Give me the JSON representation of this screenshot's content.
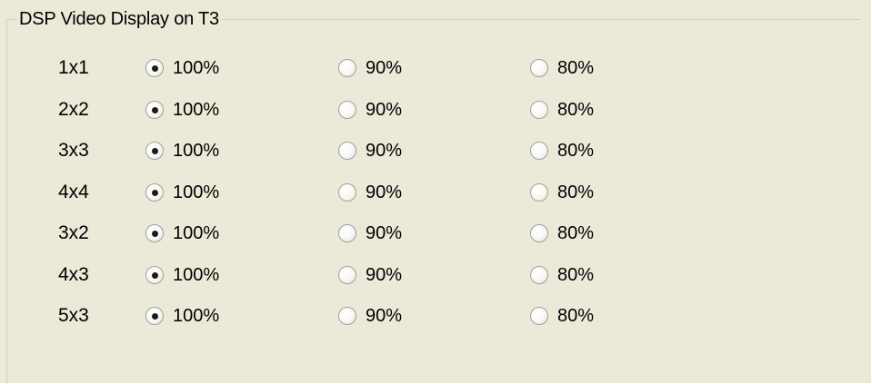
{
  "group": {
    "title": "DSP Video Display on T3"
  },
  "rows": [
    {
      "label": "1x1",
      "options": [
        "100%",
        "90%",
        "80%"
      ],
      "selected": 0
    },
    {
      "label": "2x2",
      "options": [
        "100%",
        "90%",
        "80%"
      ],
      "selected": 0
    },
    {
      "label": "3x3",
      "options": [
        "100%",
        "90%",
        "80%"
      ],
      "selected": 0
    },
    {
      "label": "4x4",
      "options": [
        "100%",
        "90%",
        "80%"
      ],
      "selected": 0
    },
    {
      "label": "3x2",
      "options": [
        "100%",
        "90%",
        "80%"
      ],
      "selected": 0
    },
    {
      "label": "4x3",
      "options": [
        "100%",
        "90%",
        "80%"
      ],
      "selected": 0
    },
    {
      "label": "5x3",
      "options": [
        "100%",
        "90%",
        "80%"
      ],
      "selected": 0
    }
  ]
}
